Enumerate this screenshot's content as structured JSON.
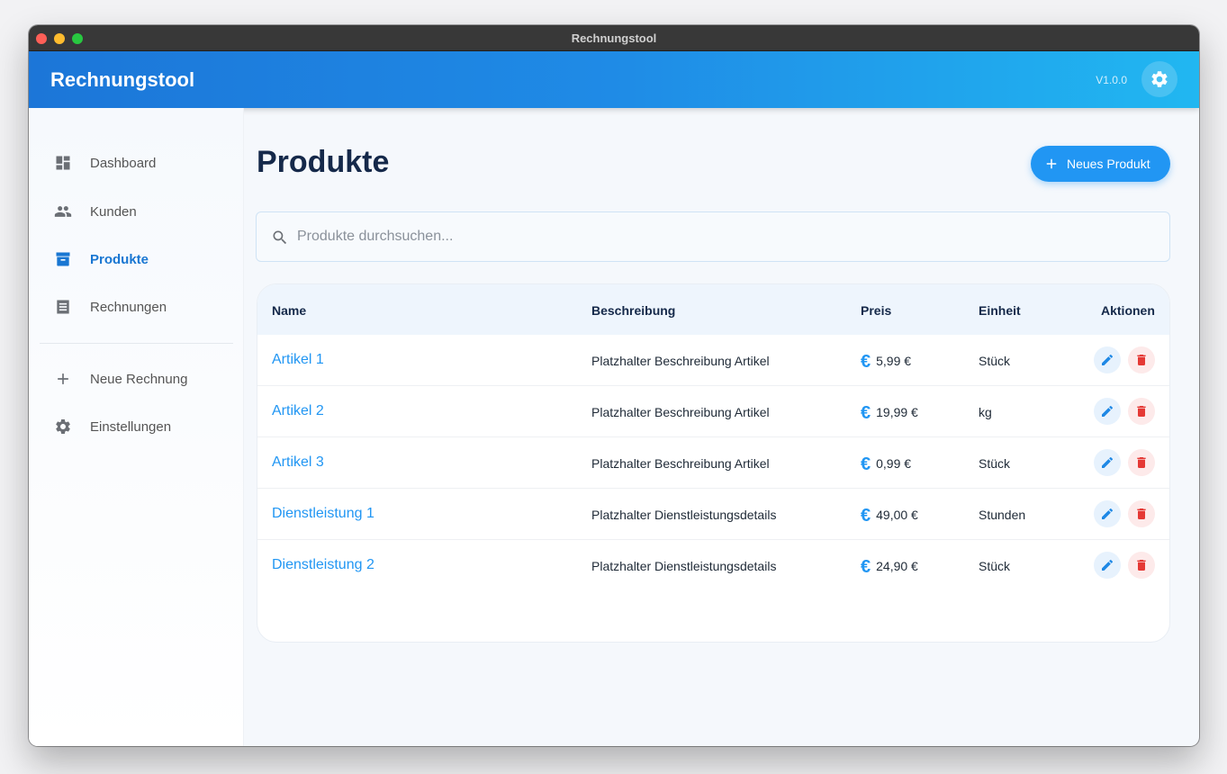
{
  "window": {
    "title": "Rechnungstool"
  },
  "appbar": {
    "brand": "Rechnungstool",
    "version": "V1.0.0",
    "settings_icon": "gear-icon"
  },
  "sidebar": {
    "items": [
      {
        "label": "Dashboard",
        "icon": "dashboard-icon",
        "active": false
      },
      {
        "label": "Kunden",
        "icon": "people-icon",
        "active": false
      },
      {
        "label": "Produkte",
        "icon": "archive-box-icon",
        "active": true
      },
      {
        "label": "Rechnungen",
        "icon": "receipt-icon",
        "active": false
      }
    ],
    "secondary": [
      {
        "label": "Neue Rechnung",
        "icon": "plus-icon"
      },
      {
        "label": "Einstellungen",
        "icon": "gear-icon"
      }
    ]
  },
  "main": {
    "title": "Produkte",
    "new_button": "Neues Produkt",
    "search": {
      "placeholder": "Produkte durchsuchen..."
    },
    "table": {
      "headers": {
        "name": "Name",
        "description": "Beschreibung",
        "price": "Preis",
        "unit": "Einheit",
        "actions": "Aktionen"
      },
      "currency_symbol": "€",
      "rows": [
        {
          "name": "Artikel 1",
          "description": "Platzhalter Beschreibung Artikel",
          "price": "5,99 €",
          "unit": "Stück"
        },
        {
          "name": "Artikel 2",
          "description": "Platzhalter Beschreibung Artikel",
          "price": "19,99 €",
          "unit": "kg"
        },
        {
          "name": "Artikel 3",
          "description": "Platzhalter Beschreibung Artikel",
          "price": "0,99 €",
          "unit": "Stück"
        },
        {
          "name": "Dienstleistung 1",
          "description": "Platzhalter Dienstleistungsdetails",
          "price": "49,00 €",
          "unit": "Stunden"
        },
        {
          "name": "Dienstleistung 2",
          "description": "Platzhalter Dienstleistungsdetails",
          "price": "24,90 €",
          "unit": "Stück"
        }
      ]
    }
  },
  "colors": {
    "accent": "#2196f3",
    "active_nav": "#1976d2",
    "delete": "#e53935",
    "title": "#15294a"
  }
}
